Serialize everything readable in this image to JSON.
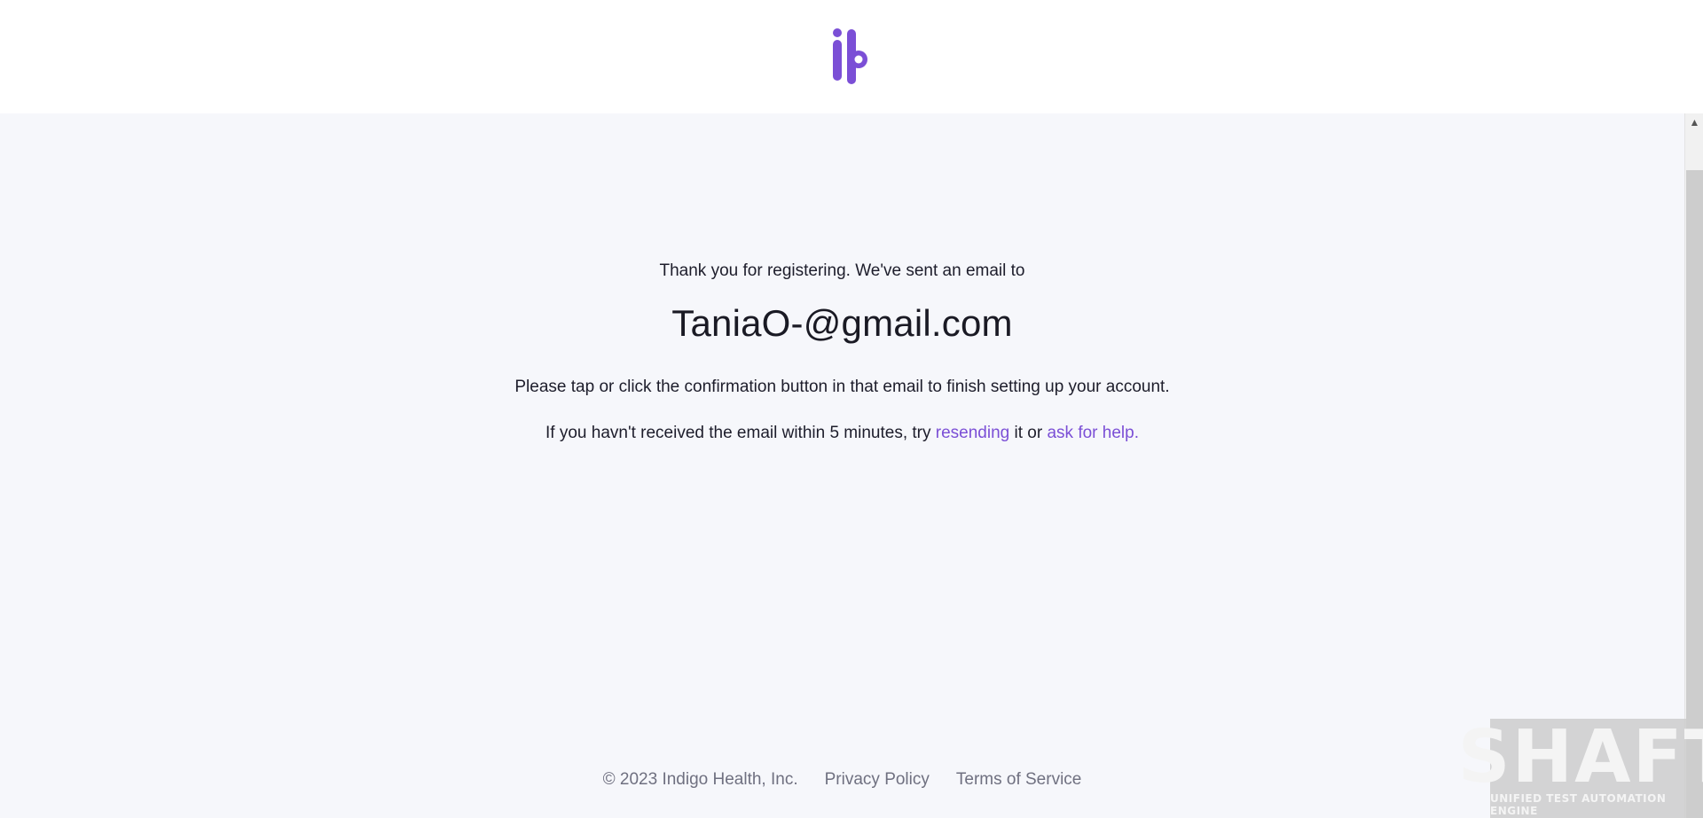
{
  "header": {
    "logo_icon": "indigo-health-logo-icon"
  },
  "confirmation": {
    "intro": "Thank you for registering. We've sent an email to",
    "email": "TaniaO-@gmail.com",
    "instructions": "Please tap or click the confirmation button in that email to finish setting up your account.",
    "resend_prefix": "If you havn't received the email within 5 minutes, try",
    "resend_link": "resending",
    "resend_middle": "it or",
    "help_link": "ask for help."
  },
  "footer": {
    "copyright": "© 2023 Indigo Health, Inc.",
    "privacy": "Privacy Policy",
    "terms": "Terms of Service"
  },
  "watermark": {
    "title": "SHAFT",
    "subtitle": "UNIFIED TEST AUTOMATION ENGINE"
  },
  "colors": {
    "accent": "#7b4fd6",
    "background": "#f6f7fb",
    "header_bg": "#ffffff",
    "footer_text": "#6f7080"
  }
}
